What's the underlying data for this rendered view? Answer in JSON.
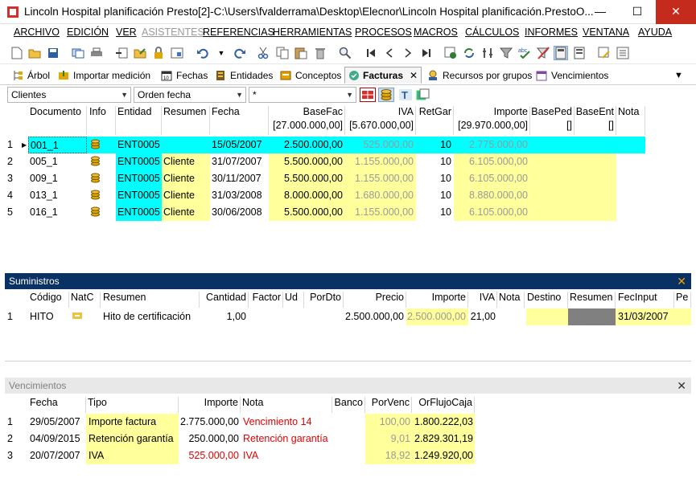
{
  "window": {
    "title": "Lincoln Hospital planificación Presto[2]-C:\\Users\\fvalderrama\\Desktop\\Elecnor\\Lincoln Hospital planificación.PrestoO...",
    "minimize": "—",
    "maximize": "☐",
    "close": "✕"
  },
  "menu": [
    "ARCHIVO",
    "EDICIÓN",
    "VER",
    "ASISTENTES",
    "REFERENCIAS",
    "HERRAMIENTAS",
    "PROCESOS",
    "MACROS",
    "CÁLCULOS",
    "INFORMES",
    "VENTANA",
    "AYUDA"
  ],
  "tabs": [
    {
      "label": "Árbol",
      "icon": "tree-icon"
    },
    {
      "label": "Importar medición",
      "icon": "import-icon"
    },
    {
      "label": "Fechas",
      "icon": "calendar-icon"
    },
    {
      "label": "Entidades",
      "icon": "entities-icon"
    },
    {
      "label": "Conceptos",
      "icon": "concepts-icon"
    },
    {
      "label": "Facturas",
      "icon": "invoices-icon",
      "active": true,
      "close": "✕"
    },
    {
      "label": "Recursos por grupos",
      "icon": "resources-icon"
    },
    {
      "label": "Vencimientos",
      "icon": "due-dates-icon"
    }
  ],
  "tab_overflow": "▼",
  "filters": {
    "f1": "Clientes",
    "f2": "Orden fecha",
    "f3": "*"
  },
  "facturas": {
    "headers": {
      "documento": "Documento",
      "info": "Info",
      "entidad": "Entidad",
      "resumen": "Resumen",
      "fecha": "Fecha",
      "basefac": "BaseFac",
      "basefac_total": "[27.000.000,00]",
      "iva": "IVA",
      "iva_total": "[5.670.000,00]",
      "retgar": "RetGar",
      "importe": "Importe",
      "importe_total": "[29.970.000,00]",
      "baseped": "BasePed",
      "baseped_total": "[]",
      "baseent": "BaseEnt",
      "baseent_total": "[]",
      "nota": "Nota"
    },
    "rows": [
      {
        "n": "1",
        "doc": "001_1",
        "ent": "ENT0005",
        "res": "",
        "fecha": "15/05/2007",
        "base": "2.500.000,00",
        "iva": "525.000,00",
        "ret": "10",
        "imp": "2.775.000,00"
      },
      {
        "n": "2",
        "doc": "005_1",
        "ent": "ENT0005",
        "res": "Cliente",
        "fecha": "31/07/2007",
        "base": "5.500.000,00",
        "iva": "1.155.000,00",
        "ret": "10",
        "imp": "6.105.000,00"
      },
      {
        "n": "3",
        "doc": "009_1",
        "ent": "ENT0005",
        "res": "Cliente",
        "fecha": "30/11/2007",
        "base": "5.500.000,00",
        "iva": "1.155.000,00",
        "ret": "10",
        "imp": "6.105.000,00"
      },
      {
        "n": "4",
        "doc": "013_1",
        "ent": "ENT0005",
        "res": "Cliente",
        "fecha": "31/03/2008",
        "base": "8.000.000,00",
        "iva": "1.680.000,00",
        "ret": "10",
        "imp": "8.880.000,00"
      },
      {
        "n": "5",
        "doc": "016_1",
        "ent": "ENT0005",
        "res": "Cliente",
        "fecha": "30/06/2008",
        "base": "5.500.000,00",
        "iva": "1.155.000,00",
        "ret": "10",
        "imp": "6.105.000,00"
      }
    ]
  },
  "suministros": {
    "title": "Suministros",
    "close": "✕",
    "headers": {
      "codigo": "Código",
      "natc": "NatC",
      "resumen": "Resumen",
      "cantidad": "Cantidad",
      "factor": "Factor",
      "ud": "Ud",
      "pordto": "PorDto",
      "precio": "Precio",
      "importe": "Importe",
      "iva": "IVA",
      "nota": "Nota",
      "destino": "Destino",
      "resumen2": "Resumen",
      "fecinput": "FecInput",
      "pe": "Pe"
    },
    "rows": [
      {
        "n": "1",
        "codigo": "HITO",
        "resumen": "Hito de certificación",
        "cantidad": "1,00",
        "precio": "2.500.000,00",
        "importe": "2.500.000,00",
        "iva": "21,00",
        "fecinput": "31/03/2007"
      }
    ]
  },
  "vencimientos": {
    "title": "Vencimientos",
    "close": "✕",
    "headers": {
      "fecha": "Fecha",
      "tipo": "Tipo",
      "importe": "Importe",
      "nota": "Nota",
      "banco": "Banco",
      "porvenc": "PorVenc",
      "orflujo": "OrFlujoCaja"
    },
    "rows": [
      {
        "n": "1",
        "fecha": "29/05/2007",
        "tipo": "Importe factura",
        "importe": "2.775.000,00",
        "nota": "Vencimiento 14",
        "porvenc": "100,00",
        "orflujo": "1.800.222,03"
      },
      {
        "n": "2",
        "fecha": "04/09/2015",
        "tipo": "Retención garantía",
        "importe": "250.000,00",
        "nota": "Retención garantía",
        "porvenc": "9,01",
        "orflujo": "2.829.301,19"
      },
      {
        "n": "3",
        "fecha": "20/07/2007",
        "tipo": "IVA",
        "importe": "525.000,00",
        "nota": "IVA",
        "porvenc": "18,92",
        "orflujo": "1.249.920,00"
      }
    ]
  },
  "colors": {
    "accent_panel": "#0a3163",
    "cyan": "#00ffff",
    "yellow": "#ffff9c"
  }
}
